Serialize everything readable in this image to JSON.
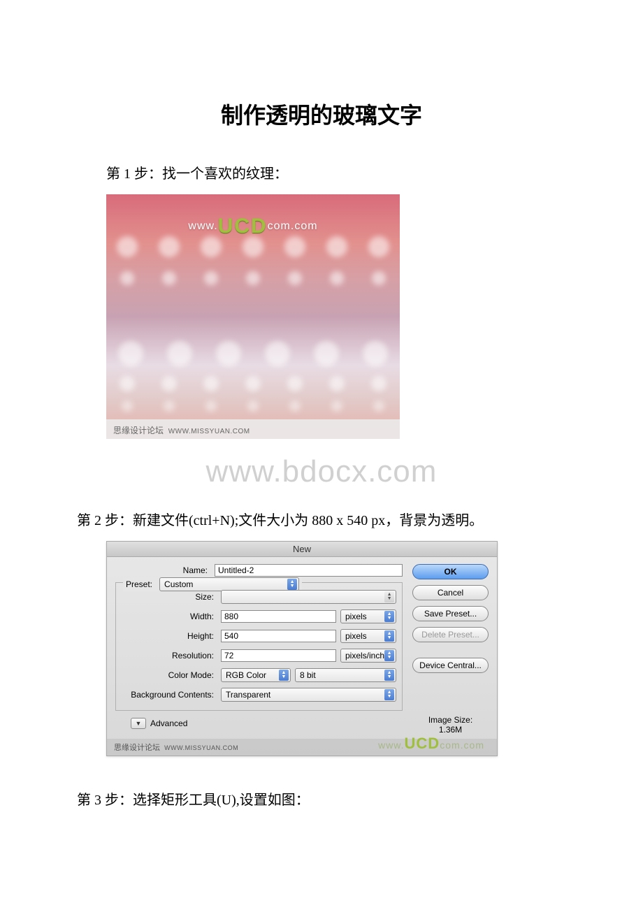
{
  "doc": {
    "title": "制作透明的玻璃文字",
    "step1": "第 1 步：找一个喜欢的纹理：",
    "step2": "第 2 步：新建文件(ctrl+N);文件大小为 880 x 540 px，背景为透明。",
    "step3": "第 3 步：选择矩形工具(U),设置如图：",
    "watermark": "www.bdocx.com"
  },
  "texture": {
    "brand_prefix": "www.",
    "brand_ucd": "UCD",
    "brand_suffix": "com.com",
    "credit_cn": "思缘设计论坛",
    "credit_url": "WWW.MISSYUAN.COM"
  },
  "dialog": {
    "title": "New",
    "name_label": "Name:",
    "name_value": "Untitled-2",
    "preset_label": "Preset:",
    "preset_value": "Custom",
    "size_label": "Size:",
    "size_value": "",
    "width_label": "Width:",
    "width_value": "880",
    "width_unit": "pixels",
    "height_label": "Height:",
    "height_value": "540",
    "height_unit": "pixels",
    "resolution_label": "Resolution:",
    "resolution_value": "72",
    "resolution_unit": "pixels/inch",
    "colormode_label": "Color Mode:",
    "colormode_value": "RGB Color",
    "colormode_depth": "8 bit",
    "bgcontents_label": "Background Contents:",
    "bgcontents_value": "Transparent",
    "advanced_label": "Advanced",
    "ok": "OK",
    "cancel": "Cancel",
    "save_preset": "Save Preset...",
    "delete_preset": "Delete Preset...",
    "device_central": "Device Central...",
    "imagesize_label": "Image Size:",
    "imagesize_value": "1.36M",
    "credit_cn": "思缘设计论坛",
    "credit_url": "WWW.MISSYUAN.COM",
    "ucd_prefix": "www.",
    "ucd_text": "UCD",
    "ucd_suffix": "com.com"
  }
}
